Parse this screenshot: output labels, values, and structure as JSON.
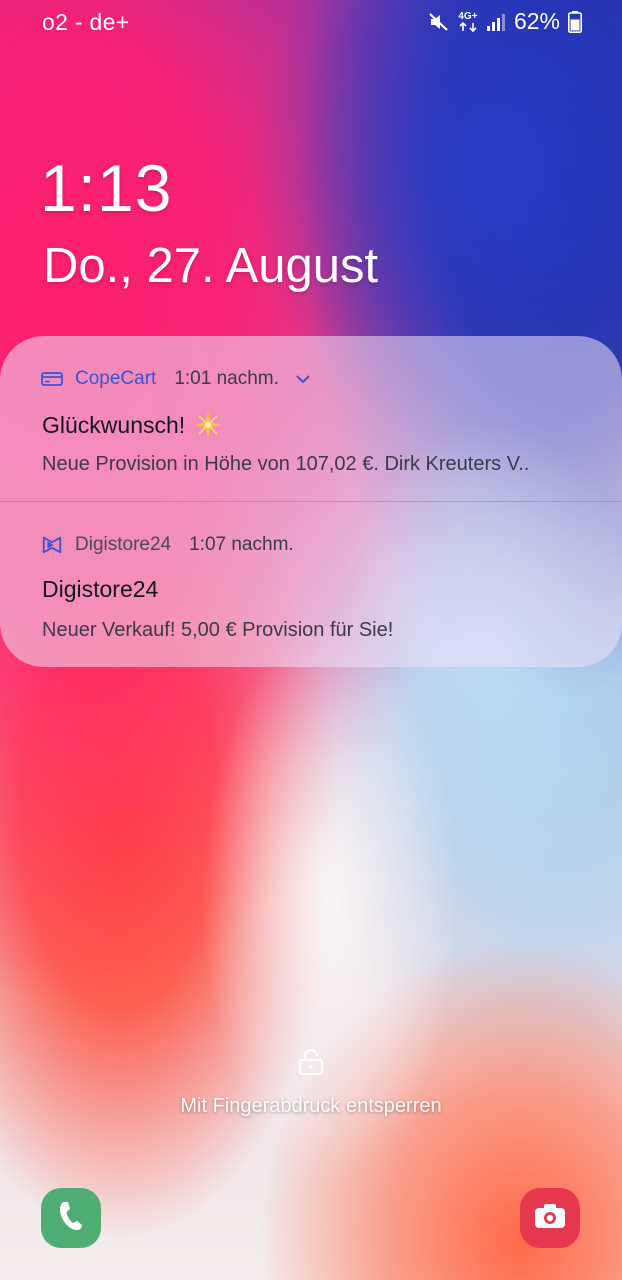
{
  "status_bar": {
    "carrier": "o2 - de+",
    "network_type": "4G+",
    "battery_percent": "62%",
    "battery_level": 0.62,
    "icons": [
      "mute-icon",
      "network-4g-icon",
      "signal-icon",
      "battery-icon"
    ]
  },
  "lockscreen": {
    "time": "1:13",
    "date": "Do., 27. August"
  },
  "notifications": [
    {
      "app_name": "CopeCart",
      "app_icon": "copecart-card-icon",
      "time": "1:01 nachm.",
      "title": "Glückwunsch!",
      "title_emoji": "sparkle-star-icon",
      "body": "Neue Provision in Höhe von 107,02 €. Dirk Kreuters V..",
      "expandable": true,
      "accent_color": "#3c52d6"
    },
    {
      "app_name": "Digistore24",
      "app_icon": "digistore24-logo-icon",
      "time": "1:07 nachm.",
      "title": "Digistore24",
      "body": "Neuer Verkauf! 5,00 € Provision für Sie!",
      "expandable": false,
      "accent_color": "#3c52d6"
    }
  ],
  "unlock": {
    "hint": "Mit Fingerabdruck entsperren",
    "icon": "lock-icon"
  },
  "shortcuts": {
    "left": {
      "icon": "phone-icon",
      "color": "#4fae74"
    },
    "right": {
      "icon": "camera-icon",
      "color": "#e5384f"
    }
  }
}
